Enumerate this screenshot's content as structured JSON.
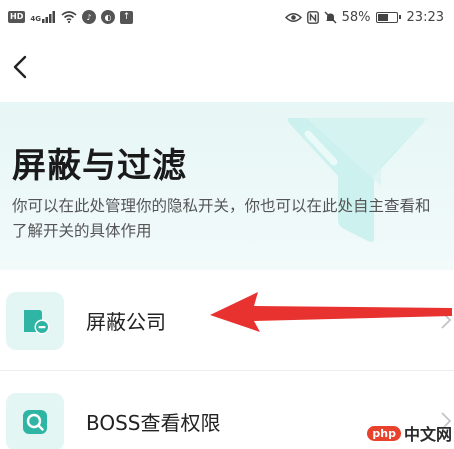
{
  "status_bar": {
    "hd_label": "HD",
    "signal_label": "4G",
    "battery_text": "58%",
    "battery_level": 0.58,
    "time": "23:23",
    "icons": [
      "wifi-icon",
      "music-icon",
      "globe-icon",
      "upload-icon",
      "eye-icon",
      "nfc-icon",
      "mute-icon",
      "battery-icon"
    ]
  },
  "nav": {
    "back_icon": "chevron-left-icon"
  },
  "hero": {
    "title": "屏蔽与过滤",
    "description": "你可以在此处管理你的隐私开关，你也可以在此处自主查看和了解开关的具体作用",
    "illustration": "funnel-icon"
  },
  "list": {
    "items": [
      {
        "label": "屏蔽公司",
        "icon": "company-block-icon"
      },
      {
        "label": "BOSS查看权限",
        "icon": "search-icon"
      }
    ]
  },
  "watermark": {
    "badge": "php",
    "text": "中文网"
  },
  "colors": {
    "accent": "#37c2b2",
    "hero_bg": "#e7f6f6",
    "icon_bg": "#e4f6f4",
    "arrow": "#e8322f"
  }
}
